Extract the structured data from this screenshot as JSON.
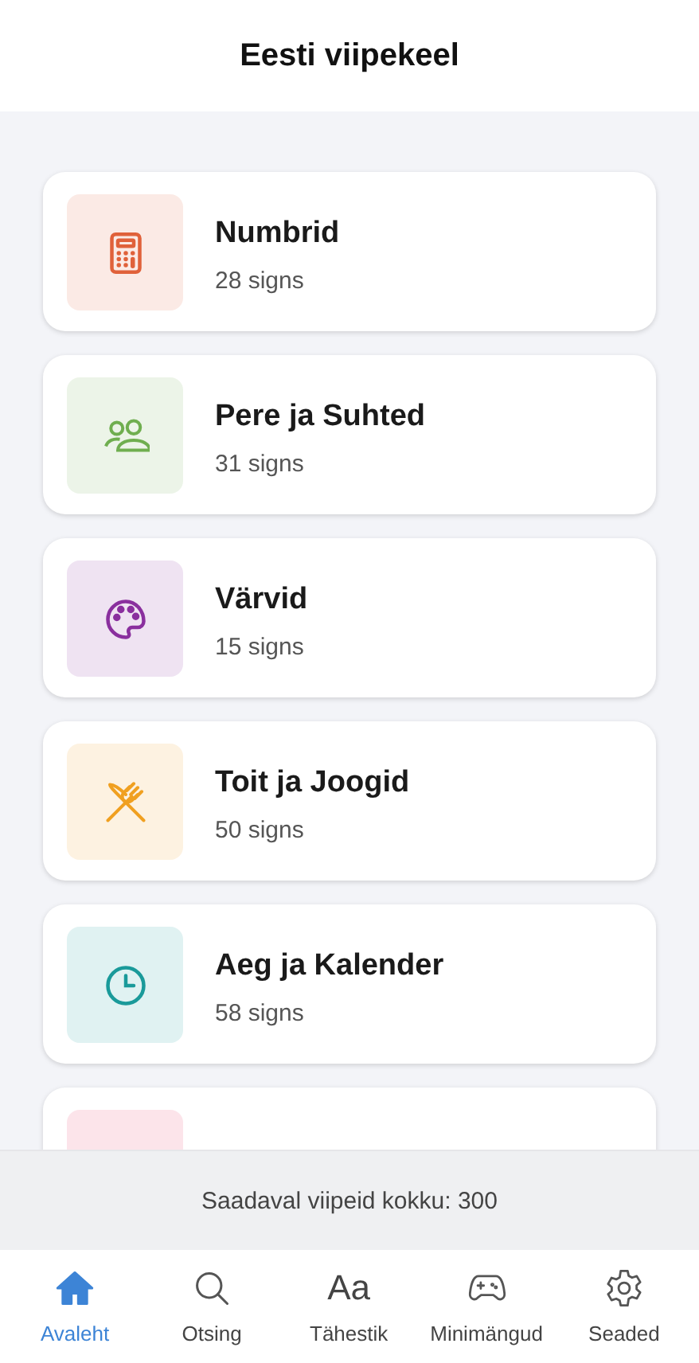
{
  "header": {
    "title": "Eesti viipekeel"
  },
  "categories": [
    {
      "kind": "calculator",
      "title": "Numbrid",
      "count": "28 signs",
      "color": "#e0613a"
    },
    {
      "kind": "people",
      "title": "Pere ja Suhted",
      "count": "31 signs",
      "color": "#6fae4f"
    },
    {
      "kind": "palette",
      "title": "Värvid",
      "count": "15 signs",
      "color": "#8a2f9e"
    },
    {
      "kind": "utensils",
      "title": "Toit ja Joogid",
      "count": "50 signs",
      "color": "#f0a020"
    },
    {
      "kind": "clock",
      "title": "Aeg ja Kalender",
      "count": "58 signs",
      "color": "#1a9a9a"
    },
    {
      "kind": "none",
      "color": "#fce4ea"
    }
  ],
  "summary": "Saadaval viipeid kokku: 300",
  "tabs": [
    {
      "kind": "home",
      "label": "Avaleht",
      "selected": true
    },
    {
      "kind": "search",
      "label": "Otsing",
      "selected": false
    },
    {
      "kind": "text",
      "glyph": "Aa",
      "label": "Tähestik",
      "selected": false
    },
    {
      "kind": "gamepad",
      "label": "Minimängud",
      "selected": false
    },
    {
      "kind": "gear",
      "label": "Seaded",
      "selected": false
    }
  ]
}
